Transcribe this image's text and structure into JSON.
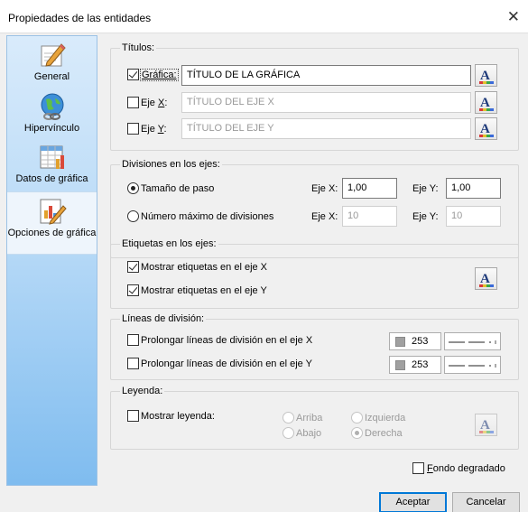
{
  "window": {
    "title": "Propiedades de las entidades",
    "close_glyph": "✕"
  },
  "sidebar": {
    "items": [
      {
        "label": "General",
        "icon": "pencil-paper-icon"
      },
      {
        "label": "Hipervínculo",
        "icon": "globe-link-icon"
      },
      {
        "label": "Datos de gráfica",
        "icon": "chart-data-icon"
      },
      {
        "label": "Opciones de gráfica",
        "icon": "chart-options-icon",
        "active": true
      }
    ]
  },
  "titulos": {
    "group_label": "Títulos:",
    "grafica": {
      "label": "Gráfica:",
      "checked": true,
      "value": "TÍTULO DE LA GRÁFICA"
    },
    "eje_x": {
      "label": "Eje X:",
      "checked": false,
      "placeholder": "TÍTULO DEL EJE X"
    },
    "eje_y": {
      "label": "Eje Y:",
      "checked": false,
      "placeholder": "TÍTULO DEL EJE Y"
    }
  },
  "divisiones": {
    "group_label": "Divisiones en los ejes:",
    "tamano": {
      "label": "Tamaño de paso",
      "selected": true,
      "x_label": "Eje X:",
      "x_value": "1,00",
      "y_label": "Eje Y:",
      "y_value": "1,00"
    },
    "maximo": {
      "label": "Número máximo de divisiones",
      "selected": false,
      "x_label": "Eje X:",
      "x_value": "10",
      "y_label": "Eje Y:",
      "y_value": "10"
    }
  },
  "etiquetas": {
    "group_label": "Etiquetas en los ejes:",
    "x": {
      "label": "Mostrar etiquetas en el eje X",
      "checked": true
    },
    "y": {
      "label": "Mostrar etiquetas en el eje Y",
      "checked": true
    }
  },
  "lineas": {
    "group_label": "Líneas de división:",
    "x": {
      "label": "Prolongar líneas de división en el eje X",
      "checked": false,
      "color_value": "253"
    },
    "y": {
      "label": "Prolongar líneas de división en el eje Y",
      "checked": false,
      "color_value": "253"
    }
  },
  "leyenda": {
    "group_label": "Leyenda:",
    "mostrar": {
      "label": "Mostrar leyenda:",
      "checked": false
    },
    "positions": {
      "arriba": "Arriba",
      "izquierda": "Izquierda",
      "abajo": "Abajo",
      "derecha": "Derecha",
      "selected": "Derecha"
    }
  },
  "fondo": {
    "label": "Fondo degradado",
    "checked": false
  },
  "buttons": {
    "accept": "Aceptar",
    "cancel": "Cancelar"
  }
}
